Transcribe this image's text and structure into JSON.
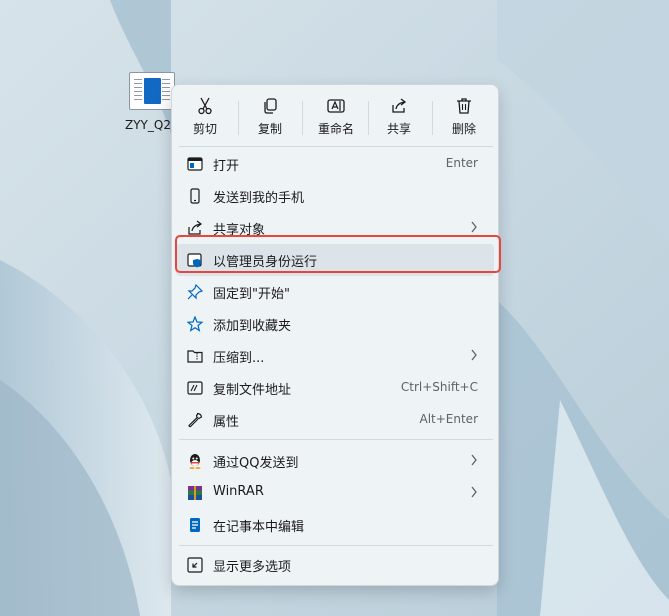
{
  "file": {
    "name": "ZYY_Q2..."
  },
  "toolbar": [
    {
      "label": "剪切",
      "icon": "scissors-icon"
    },
    {
      "label": "复制",
      "icon": "copy-icon"
    },
    {
      "label": "重命名",
      "icon": "rename-icon"
    },
    {
      "label": "共享",
      "icon": "share-icon"
    },
    {
      "label": "删除",
      "icon": "trash-icon"
    }
  ],
  "menu": [
    {
      "label": "打开",
      "shortcut": "Enter",
      "icon": "open-window-icon"
    },
    {
      "label": "发送到我的手机",
      "icon": "phone-icon"
    },
    {
      "label": "共享对象",
      "submenu": true,
      "icon": "share-icon"
    },
    {
      "label": "以管理员身份运行",
      "highlighted": true,
      "icon": "shield-icon"
    },
    {
      "label": "固定到\"开始\"",
      "icon": "pin-icon"
    },
    {
      "label": "添加到收藏夹",
      "icon": "star-icon"
    },
    {
      "label": "压缩到...",
      "submenu": true,
      "icon": "folder-zip-icon"
    },
    {
      "label": "复制文件地址",
      "shortcut": "Ctrl+Shift+C",
      "icon": "copy-path-icon"
    },
    {
      "label": "属性",
      "shortcut": "Alt+Enter",
      "icon": "wrench-icon"
    },
    {
      "label": "通过QQ发送到",
      "submenu": true,
      "icon": "qq-icon"
    },
    {
      "label": "WinRAR",
      "submenu": true,
      "icon": "winrar-icon"
    },
    {
      "label": "在记事本中编辑",
      "icon": "notepad-icon"
    },
    {
      "label": "显示更多选项",
      "icon": "more-options-icon"
    }
  ],
  "colors": {
    "highlight_border": "#e8453c",
    "accent": "#0067c0"
  }
}
